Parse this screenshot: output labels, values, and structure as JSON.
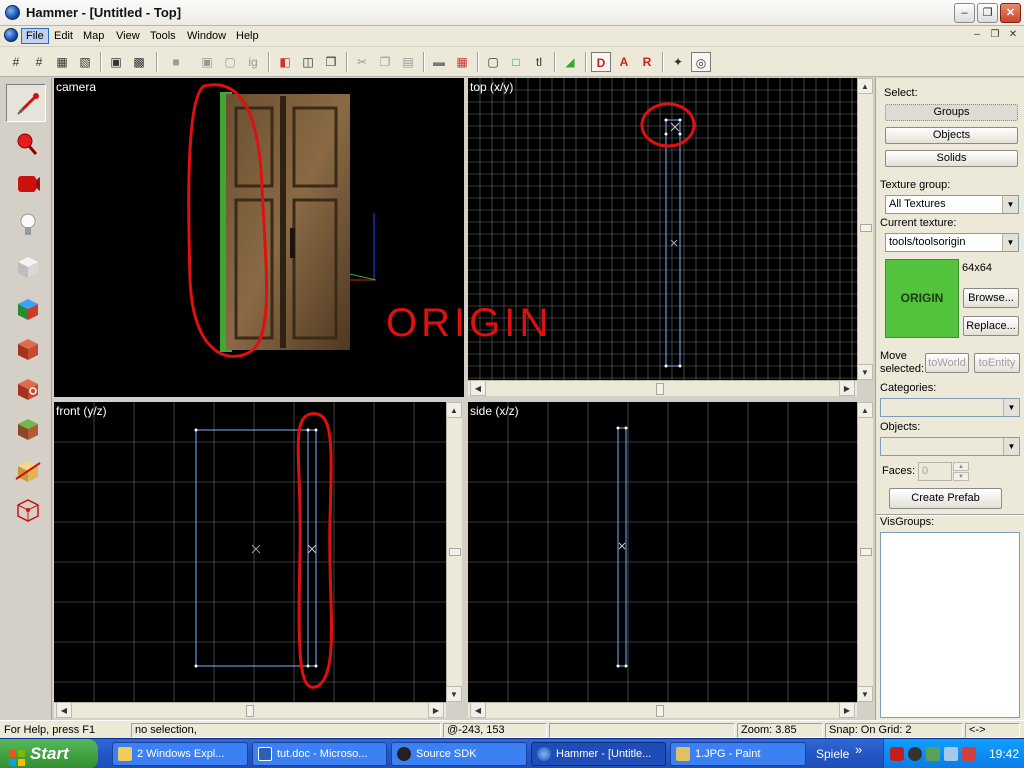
{
  "window": {
    "title": "Hammer - [Untitled - Top]",
    "minimize": "–",
    "maximize": "❐",
    "close": "✕"
  },
  "menubar": {
    "items": [
      "File",
      "Edit",
      "Map",
      "View",
      "Tools",
      "Window",
      "Help"
    ],
    "active": "File"
  },
  "viewports": {
    "camera": "camera",
    "top": "top (x/y)",
    "front": "front (y/z)",
    "side": "side (x/z)"
  },
  "annotation": {
    "label": "ORIGIN"
  },
  "right_panel": {
    "select_label": "Select:",
    "select_buttons": [
      "Groups",
      "Objects",
      "Solids"
    ],
    "selected_button": "Groups",
    "texture_group_label": "Texture group:",
    "texture_group_value": "All Textures",
    "current_texture_label": "Current texture:",
    "current_texture_value": "tools/toolsorigin",
    "texture_preview_text": "ORIGIN",
    "texture_size": "64x64",
    "browse_button": "Browse...",
    "replace_button": "Replace...",
    "move_selected_label_1": "Move",
    "move_selected_label_2": "selected:",
    "to_world_button": "toWorld",
    "to_entity_button": "toEntity",
    "categories_label": "Categories:",
    "objects_label": "Objects:",
    "faces_label": "Faces:",
    "faces_value": "0",
    "create_prefab_button": "Create Prefab",
    "visgroups_label": "VisGroups:"
  },
  "statusbar": {
    "help": "For Help, press F1",
    "selection": "no selection,",
    "coords": "@-243, 153",
    "zoom": "Zoom: 3.85",
    "snap": "Snap: On Grid: 2",
    "extra": "<->"
  },
  "taskbar": {
    "start": "Start",
    "tasks": [
      {
        "label": "2 Windows Expl...",
        "active": false
      },
      {
        "label": "tut.doc - Microso...",
        "active": false
      },
      {
        "label": "Source SDK",
        "active": false
      },
      {
        "label": "Hammer - [Untitle...",
        "active": true
      },
      {
        "label": "1.JPG - Paint",
        "active": false
      }
    ],
    "language_bar": "Spiele",
    "language_chevron": "»",
    "clock": "19:42"
  },
  "colors": {
    "accent": "#316ac5",
    "grid_line": "#6e6e6e",
    "brush_outline": "#7db2ff",
    "annotation_red": "#e01010",
    "origin_texture": "#53c23d",
    "taskbar": "#2457c6"
  }
}
